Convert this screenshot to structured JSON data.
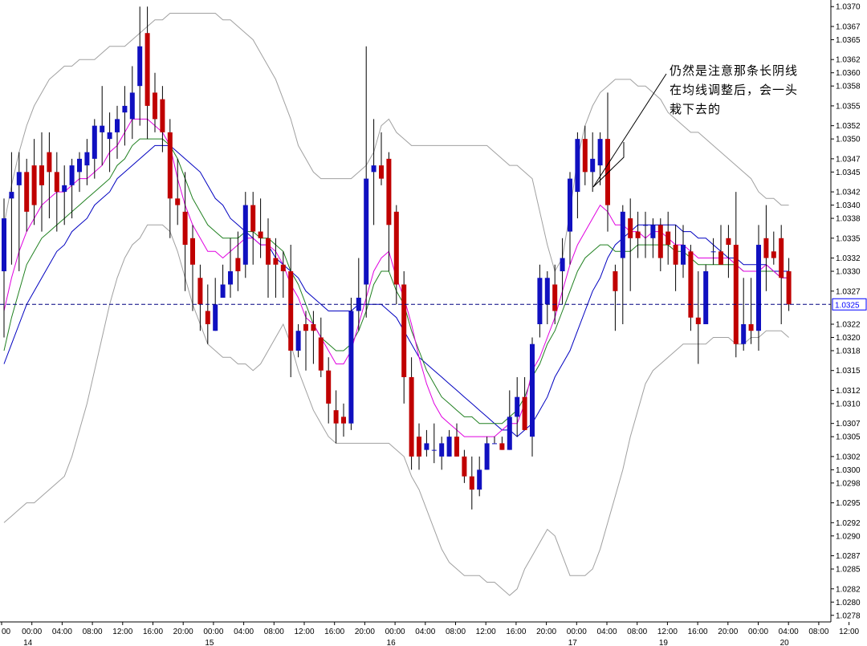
{
  "chart_data": {
    "type": "candlestick",
    "ylim": [
      1.0277,
      1.0371
    ],
    "grid": false,
    "colors": {
      "up": "#1010c0",
      "down": "#c00000",
      "upper_lower_band": "#a0a0a0",
      "fast_ma": "#e000e0",
      "mid_ma": "#208020",
      "slow_ma": "#0000c0",
      "current_price_line": "#000080",
      "current_price_box": "#0000ff"
    },
    "current_price": "1.0325",
    "y_ticks": [
      "1.0370",
      "1.0367",
      "1.0365",
      "1.0362",
      "1.0360",
      "1.0358",
      "1.0355",
      "1.0352",
      "1.0350",
      "1.0347",
      "1.0345",
      "1.0342",
      "1.0340",
      "1.0338",
      "1.0335",
      "1.0332",
      "1.0330",
      "1.0327",
      "1.0322",
      "1.0320",
      "1.0318",
      "1.0315",
      "1.0312",
      "1.0310",
      "1.0307",
      "1.0305",
      "1.0302",
      "1.0300",
      "1.0298",
      "1.0295",
      "1.0292",
      "1.0290",
      "1.0287",
      "1.0285",
      "1.0282",
      "1.0280",
      "1.0278"
    ],
    "x_time_labels": [
      "00",
      "00:00",
      "04:00",
      "08:00",
      "12:00",
      "16:00",
      "20:00",
      "00:00",
      "04:00",
      "08:00",
      "12:00",
      "16:00",
      "20:00",
      "00:00",
      "04:00",
      "08:00",
      "12:00",
      "16:00",
      "20:00",
      "00:00",
      "04:00",
      "08:00",
      "12:00",
      "16:00",
      "20:00",
      "00:00",
      "04:00",
      "08:00",
      "12:00",
      "16:00",
      "20:00",
      "00:00",
      "04:00"
    ],
    "x_day_labels": [
      "14",
      "15",
      "16",
      "17",
      "19",
      "20"
    ],
    "candles": [
      {
        "o": 1.033,
        "h": 1.0341,
        "l": 1.032,
        "c": 1.0338
      },
      {
        "o": 1.0341,
        "h": 1.0348,
        "l": 1.0331,
        "c": 1.0342
      },
      {
        "o": 1.0343,
        "h": 1.0348,
        "l": 1.033,
        "c": 1.0345
      },
      {
        "o": 1.0345,
        "h": 1.0347,
        "l": 1.0336,
        "c": 1.0339
      },
      {
        "o": 1.0346,
        "h": 1.035,
        "l": 1.0337,
        "c": 1.034
      },
      {
        "o": 1.0346,
        "h": 1.0351,
        "l": 1.0336,
        "c": 1.0343
      },
      {
        "o": 1.0348,
        "h": 1.0351,
        "l": 1.0338,
        "c": 1.0345
      },
      {
        "o": 1.0345,
        "h": 1.0348,
        "l": 1.0336,
        "c": 1.0342
      },
      {
        "o": 1.0342,
        "h": 1.0346,
        "l": 1.0337,
        "c": 1.0343
      },
      {
        "o": 1.0343,
        "h": 1.0347,
        "l": 1.0338,
        "c": 1.0346
      },
      {
        "o": 1.0345,
        "h": 1.0348,
        "l": 1.0342,
        "c": 1.0347
      },
      {
        "o": 1.0346,
        "h": 1.035,
        "l": 1.0343,
        "c": 1.0348
      },
      {
        "o": 1.0347,
        "h": 1.0353,
        "l": 1.0344,
        "c": 1.0352
      },
      {
        "o": 1.0351,
        "h": 1.0358,
        "l": 1.0346,
        "c": 1.0352
      },
      {
        "o": 1.035,
        "h": 1.0354,
        "l": 1.0345,
        "c": 1.0351
      },
      {
        "o": 1.0351,
        "h": 1.0355,
        "l": 1.0347,
        "c": 1.0353
      },
      {
        "o": 1.0354,
        "h": 1.0358,
        "l": 1.0349,
        "c": 1.0355
      },
      {
        "o": 1.0353,
        "h": 1.0361,
        "l": 1.035,
        "c": 1.0357
      },
      {
        "o": 1.0358,
        "h": 1.037,
        "l": 1.0352,
        "c": 1.0364
      },
      {
        "o": 1.0366,
        "h": 1.037,
        "l": 1.035,
        "c": 1.0355
      },
      {
        "o": 1.0357,
        "h": 1.036,
        "l": 1.0351,
        "c": 1.0353
      },
      {
        "o": 1.0356,
        "h": 1.0358,
        "l": 1.0348,
        "c": 1.0351
      },
      {
        "o": 1.0351,
        "h": 1.0353,
        "l": 1.0335,
        "c": 1.0341
      },
      {
        "o": 1.0341,
        "h": 1.0347,
        "l": 1.0337,
        "c": 1.034
      },
      {
        "o": 1.0339,
        "h": 1.0345,
        "l": 1.0327,
        "c": 1.0334
      },
      {
        "o": 1.0335,
        "h": 1.0337,
        "l": 1.0324,
        "c": 1.0331
      },
      {
        "o": 1.0329,
        "h": 1.0331,
        "l": 1.0321,
        "c": 1.0325
      },
      {
        "o": 1.0324,
        "h": 1.0328,
        "l": 1.0319,
        "c": 1.0322
      },
      {
        "o": 1.0321,
        "h": 1.0329,
        "l": 1.0321,
        "c": 1.0325
      },
      {
        "o": 1.0326,
        "h": 1.0331,
        "l": 1.0326,
        "c": 1.0328
      },
      {
        "o": 1.0328,
        "h": 1.0335,
        "l": 1.0326,
        "c": 1.033
      },
      {
        "o": 1.0332,
        "h": 1.0336,
        "l": 1.0327,
        "c": 1.033
      },
      {
        "o": 1.0331,
        "h": 1.0342,
        "l": 1.0329,
        "c": 1.034
      },
      {
        "o": 1.034,
        "h": 1.0342,
        "l": 1.0331,
        "c": 1.0336
      },
      {
        "o": 1.0336,
        "h": 1.0341,
        "l": 1.0332,
        "c": 1.0335
      },
      {
        "o": 1.0335,
        "h": 1.0338,
        "l": 1.0326,
        "c": 1.0331
      },
      {
        "o": 1.0332,
        "h": 1.0335,
        "l": 1.0326,
        "c": 1.0331
      },
      {
        "o": 1.0331,
        "h": 1.0333,
        "l": 1.0326,
        "c": 1.033
      },
      {
        "o": 1.033,
        "h": 1.0334,
        "l": 1.0314,
        "c": 1.0318
      },
      {
        "o": 1.0318,
        "h": 1.0322,
        "l": 1.0317,
        "c": 1.0321
      },
      {
        "o": 1.0322,
        "h": 1.0324,
        "l": 1.0315,
        "c": 1.0321
      },
      {
        "o": 1.0322,
        "h": 1.0324,
        "l": 1.0316,
        "c": 1.0321
      },
      {
        "o": 1.032,
        "h": 1.0323,
        "l": 1.0314,
        "c": 1.0315
      },
      {
        "o": 1.0315,
        "h": 1.0317,
        "l": 1.0307,
        "c": 1.031
      },
      {
        "o": 1.0309,
        "h": 1.0312,
        "l": 1.0304,
        "c": 1.0307
      },
      {
        "o": 1.0308,
        "h": 1.031,
        "l": 1.0305,
        "c": 1.0307
      },
      {
        "o": 1.0307,
        "h": 1.0326,
        "l": 1.0306,
        "c": 1.0324
      },
      {
        "o": 1.0324,
        "h": 1.0332,
        "l": 1.0321,
        "c": 1.0326
      },
      {
        "o": 1.0328,
        "h": 1.0364,
        "l": 1.0323,
        "c": 1.0344
      },
      {
        "o": 1.0345,
        "h": 1.0353,
        "l": 1.0337,
        "c": 1.0346
      },
      {
        "o": 1.0346,
        "h": 1.0351,
        "l": 1.0343,
        "c": 1.0344
      },
      {
        "o": 1.0347,
        "h": 1.0348,
        "l": 1.033,
        "c": 1.0337
      },
      {
        "o": 1.0339,
        "h": 1.034,
        "l": 1.0325,
        "c": 1.0328
      },
      {
        "o": 1.0328,
        "h": 1.033,
        "l": 1.031,
        "c": 1.0314
      },
      {
        "o": 1.0314,
        "h": 1.0317,
        "l": 1.03,
        "c": 1.0302
      },
      {
        "o": 1.0305,
        "h": 1.0307,
        "l": 1.03,
        "c": 1.0302
      },
      {
        "o": 1.0303,
        "h": 1.0306,
        "l": 1.0302,
        "c": 1.0304
      },
      {
        "o": 1.0303,
        "h": 1.0307,
        "l": 1.0301,
        "c": 1.0303
      },
      {
        "o": 1.0302,
        "h": 1.0305,
        "l": 1.03,
        "c": 1.0304
      },
      {
        "o": 1.0302,
        "h": 1.0306,
        "l": 1.0302,
        "c": 1.0305
      },
      {
        "o": 1.0305,
        "h": 1.0307,
        "l": 1.0302,
        "c": 1.0302
      },
      {
        "o": 1.0302,
        "h": 1.0303,
        "l": 1.0298,
        "c": 1.0299
      },
      {
        "o": 1.0299,
        "h": 1.0302,
        "l": 1.0294,
        "c": 1.0297
      },
      {
        "o": 1.0297,
        "h": 1.0302,
        "l": 1.0296,
        "c": 1.03
      },
      {
        "o": 1.03,
        "h": 1.0305,
        "l": 1.03,
        "c": 1.0304
      },
      {
        "o": 1.0304,
        "h": 1.0305,
        "l": 1.0304,
        "c": 1.0304
      },
      {
        "o": 1.0304,
        "h": 1.0305,
        "l": 1.0303,
        "c": 1.0303
      },
      {
        "o": 1.0303,
        "h": 1.0312,
        "l": 1.0303,
        "c": 1.0308
      },
      {
        "o": 1.0308,
        "h": 1.0314,
        "l": 1.0305,
        "c": 1.0311
      },
      {
        "o": 1.0311,
        "h": 1.0314,
        "l": 1.0306,
        "c": 1.0306
      },
      {
        "o": 1.0305,
        "h": 1.032,
        "l": 1.0302,
        "c": 1.0319
      },
      {
        "o": 1.0322,
        "h": 1.0331,
        "l": 1.032,
        "c": 1.0329
      },
      {
        "o": 1.0325,
        "h": 1.033,
        "l": 1.0322,
        "c": 1.0329
      },
      {
        "o": 1.0328,
        "h": 1.0331,
        "l": 1.0322,
        "c": 1.0324
      },
      {
        "o": 1.033,
        "h": 1.0335,
        "l": 1.0325,
        "c": 1.0332
      },
      {
        "o": 1.0336,
        "h": 1.0345,
        "l": 1.0331,
        "c": 1.0344
      },
      {
        "o": 1.0342,
        "h": 1.0351,
        "l": 1.0338,
        "c": 1.035
      },
      {
        "o": 1.035,
        "h": 1.0352,
        "l": 1.0343,
        "c": 1.0345
      },
      {
        "o": 1.0345,
        "h": 1.0351,
        "l": 1.0342,
        "c": 1.0347
      },
      {
        "o": 1.0346,
        "h": 1.0351,
        "l": 1.0343,
        "c": 1.035
      },
      {
        "o": 1.035,
        "h": 1.0357,
        "l": 1.0336,
        "c": 1.034
      },
      {
        "o": 1.033,
        "h": 1.0331,
        "l": 1.0321,
        "c": 1.0327
      },
      {
        "o": 1.0332,
        "h": 1.034,
        "l": 1.0322,
        "c": 1.0339
      },
      {
        "o": 1.0338,
        "h": 1.0341,
        "l": 1.0327,
        "c": 1.0335
      },
      {
        "o": 1.0336,
        "h": 1.0339,
        "l": 1.0332,
        "c": 1.0335
      },
      {
        "o": 1.0337,
        "h": 1.0339,
        "l": 1.0332,
        "c": 1.0337
      },
      {
        "o": 1.0335,
        "h": 1.0338,
        "l": 1.0332,
        "c": 1.0337
      },
      {
        "o": 1.0337,
        "h": 1.0338,
        "l": 1.033,
        "c": 1.0332
      },
      {
        "o": 1.0336,
        "h": 1.0339,
        "l": 1.0331,
        "c": 1.0334
      },
      {
        "o": 1.0334,
        "h": 1.0337,
        "l": 1.0327,
        "c": 1.0331
      },
      {
        "o": 1.0331,
        "h": 1.0337,
        "l": 1.0329,
        "c": 1.0334
      },
      {
        "o": 1.0333,
        "h": 1.0334,
        "l": 1.0321,
        "c": 1.0323
      },
      {
        "o": 1.0323,
        "h": 1.033,
        "l": 1.0316,
        "c": 1.0322
      },
      {
        "o": 1.0322,
        "h": 1.0331,
        "l": 1.0322,
        "c": 1.033
      },
      {
        "o": 1.0333,
        "h": 1.0335,
        "l": 1.0331,
        "c": 1.0333
      },
      {
        "o": 1.0333,
        "h": 1.0337,
        "l": 1.0331,
        "c": 1.0331
      },
      {
        "o": 1.0335,
        "h": 1.0337,
        "l": 1.0329,
        "c": 1.0334
      },
      {
        "o": 1.0334,
        "h": 1.0342,
        "l": 1.0317,
        "c": 1.0319
      },
      {
        "o": 1.0319,
        "h": 1.0329,
        "l": 1.0318,
        "c": 1.0322
      },
      {
        "o": 1.0322,
        "h": 1.0329,
        "l": 1.0319,
        "c": 1.0321
      },
      {
        "o": 1.0321,
        "h": 1.0337,
        "l": 1.0318,
        "c": 1.0334
      },
      {
        "o": 1.0335,
        "h": 1.034,
        "l": 1.0327,
        "c": 1.0332
      },
      {
        "o": 1.0333,
        "h": 1.0336,
        "l": 1.0331,
        "c": 1.0332
      },
      {
        "o": 1.0335,
        "h": 1.0337,
        "l": 1.0322,
        "c": 1.0329
      },
      {
        "o": 1.033,
        "h": 1.0332,
        "l": 1.0324,
        "c": 1.0325
      }
    ],
    "upper_band": [
      1.0337,
      1.0343,
      1.0348,
      1.0352,
      1.0355,
      1.0357,
      1.0359,
      1.036,
      1.0361,
      1.0361,
      1.0362,
      1.0362,
      1.0362,
      1.0363,
      1.0364,
      1.0364,
      1.0364,
      1.0365,
      1.0366,
      1.0367,
      1.0368,
      1.0368,
      1.0369,
      1.0369,
      1.0369,
      1.0369,
      1.0369,
      1.0369,
      1.0369,
      1.0368,
      1.0368,
      1.0367,
      1.0366,
      1.0365,
      1.0363,
      1.0361,
      1.0359,
      1.0356,
      1.0353,
      1.0349,
      1.0347,
      1.0345,
      1.0344,
      1.0344,
      1.0344,
      1.0344,
      1.0344,
      1.0345,
      1.0346,
      1.0348,
      1.0352,
      1.0353,
      1.0351,
      1.035,
      1.0349,
      1.0349,
      1.0349,
      1.0349,
      1.0349,
      1.0349,
      1.0349,
      1.0349,
      1.0349,
      1.0349,
      1.0349,
      1.0348,
      1.0347,
      1.0346,
      1.0346,
      1.0345,
      1.0344,
      1.0339,
      1.0334,
      1.033,
      1.0332,
      1.0339,
      1.0347,
      1.0352,
      1.0355,
      1.0357,
      1.0358,
      1.0359,
      1.0359,
      1.0359,
      1.0358,
      1.0358,
      1.0357,
      1.0356,
      1.0354,
      1.0353,
      1.0352,
      1.0351,
      1.0351,
      1.035,
      1.0349,
      1.0348,
      1.0347,
      1.0346,
      1.0345,
      1.0344,
      1.0342,
      1.0341,
      1.0341,
      1.034,
      1.034
    ],
    "lower_band": [
      1.0292,
      1.0293,
      1.0294,
      1.0295,
      1.0295,
      1.0296,
      1.0297,
      1.0298,
      1.0299,
      1.0302,
      1.0306,
      1.031,
      1.0315,
      1.032,
      1.0325,
      1.0329,
      1.0332,
      1.0334,
      1.0335,
      1.0337,
      1.0337,
      1.0337,
      1.0336,
      1.0333,
      1.0329,
      1.0325,
      1.0322,
      1.0319,
      1.0318,
      1.0317,
      1.0317,
      1.0316,
      1.0316,
      1.0315,
      1.0316,
      1.0318,
      1.032,
      1.0322,
      1.0319,
      1.0315,
      1.0312,
      1.0309,
      1.0307,
      1.0305,
      1.0304,
      1.0304,
      1.0304,
      1.0304,
      1.0304,
      1.0304,
      1.0304,
      1.0304,
      1.0303,
      1.0302,
      1.0299,
      1.0297,
      1.0294,
      1.0291,
      1.0288,
      1.0286,
      1.0285,
      1.0284,
      1.0284,
      1.0284,
      1.0283,
      1.0283,
      1.0282,
      1.0281,
      1.0282,
      1.0285,
      1.0287,
      1.0289,
      1.0291,
      1.029,
      1.0287,
      1.0284,
      1.0284,
      1.0284,
      1.0285,
      1.0288,
      1.0292,
      1.0296,
      1.03,
      1.0305,
      1.0309,
      1.0313,
      1.0315,
      1.0316,
      1.0317,
      1.0318,
      1.0319,
      1.0319,
      1.0319,
      1.0319,
      1.032,
      1.032,
      1.032,
      1.0319,
      1.0319,
      1.032,
      1.032,
      1.0321,
      1.0321,
      1.0321,
      1.032
    ],
    "fast_ma": [
      1.0324,
      1.0329,
      1.0333,
      1.0336,
      1.0338,
      1.034,
      1.0341,
      1.0342,
      1.0342,
      1.0343,
      1.0344,
      1.0344,
      1.0345,
      1.0346,
      1.0348,
      1.0349,
      1.0351,
      1.0353,
      1.0353,
      1.0353,
      1.0352,
      1.0351,
      1.0349,
      1.0344,
      1.034,
      1.0337,
      1.0335,
      1.0333,
      1.0333,
      1.0332,
      1.0333,
      1.0334,
      1.0335,
      1.0335,
      1.0334,
      1.0334,
      1.0333,
      1.0331,
      1.0328,
      1.0326,
      1.0323,
      1.0322,
      1.032,
      1.0318,
      1.0316,
      1.0316,
      1.0318,
      1.0322,
      1.0326,
      1.033,
      1.0332,
      1.0333,
      1.0329,
      1.0326,
      1.0322,
      1.0317,
      1.0313,
      1.031,
      1.0308,
      1.0307,
      1.0306,
      1.0305,
      1.0305,
      1.0305,
      1.0305,
      1.0305,
      1.0306,
      1.0307,
      1.0307,
      1.031,
      1.0315,
      1.0317,
      1.032,
      1.0323,
      1.0327,
      1.0331,
      1.0334,
      1.0336,
      1.0338,
      1.034,
      1.0339,
      1.0337,
      1.0337,
      1.0336,
      1.0336,
      1.0335,
      1.0336,
      1.0336,
      1.0335,
      1.0334,
      1.0334,
      1.0333,
      1.0332,
      1.0332,
      1.0332,
      1.0332,
      1.0332,
      1.0331,
      1.033,
      1.033,
      1.033,
      1.0331,
      1.033,
      1.0329,
      1.0329
    ],
    "mid_ma": [
      1.0318,
      1.0323,
      1.0327,
      1.0331,
      1.0333,
      1.0335,
      1.0336,
      1.0337,
      1.0338,
      1.0339,
      1.034,
      1.0341,
      1.0342,
      1.0343,
      1.0344,
      1.0346,
      1.0347,
      1.0349,
      1.035,
      1.035,
      1.035,
      1.035,
      1.0349,
      1.0347,
      1.0344,
      1.0341,
      1.0339,
      1.0337,
      1.0336,
      1.0335,
      1.0335,
      1.0335,
      1.0336,
      1.0336,
      1.0335,
      1.0335,
      1.0334,
      1.0333,
      1.033,
      1.0328,
      1.0325,
      1.0322,
      1.032,
      1.0319,
      1.0318,
      1.0318,
      1.0319,
      1.0321,
      1.0324,
      1.0328,
      1.033,
      1.033,
      1.0327,
      1.0325,
      1.0321,
      1.0318,
      1.0315,
      1.0313,
      1.0311,
      1.031,
      1.0309,
      1.0308,
      1.0308,
      1.0307,
      1.0307,
      1.0307,
      1.0307,
      1.0308,
      1.0309,
      1.0311,
      1.0314,
      1.0316,
      1.0319,
      1.0321,
      1.0324,
      1.0327,
      1.033,
      1.0332,
      1.0333,
      1.0334,
      1.0334,
      1.0333,
      1.0333,
      1.0333,
      1.0334,
      1.0334,
      1.0334,
      1.0334,
      1.0334,
      1.0333,
      1.0333,
      1.0332,
      1.0331,
      1.0331,
      1.0331,
      1.0331,
      1.0331,
      1.0331,
      1.033,
      1.033,
      1.033,
      1.033,
      1.033,
      1.0329,
      1.0329
    ],
    "slow_ma": [
      1.0316,
      1.0319,
      1.0322,
      1.0325,
      1.0327,
      1.0329,
      1.0331,
      1.0333,
      1.0334,
      1.0336,
      1.0337,
      1.0338,
      1.034,
      1.0341,
      1.0342,
      1.0344,
      1.0345,
      1.0346,
      1.0347,
      1.0348,
      1.0349,
      1.0349,
      1.0349,
      1.0348,
      1.0347,
      1.0346,
      1.0345,
      1.0343,
      1.0341,
      1.034,
      1.0338,
      1.0337,
      1.0336,
      1.0335,
      1.0334,
      1.0334,
      1.0332,
      1.0331,
      1.033,
      1.0329,
      1.0327,
      1.0326,
      1.0325,
      1.0324,
      1.0324,
      1.0324,
      1.0324,
      1.0325,
      1.0325,
      1.0325,
      1.0325,
      1.0324,
      1.0323,
      1.0321,
      1.0319,
      1.0317,
      1.0316,
      1.0315,
      1.0314,
      1.0313,
      1.0312,
      1.0311,
      1.031,
      1.0309,
      1.0308,
      1.0307,
      1.0306,
      1.0306,
      1.0305,
      1.0306,
      1.0307,
      1.0309,
      1.0311,
      1.0314,
      1.0316,
      1.0318,
      1.0321,
      1.0324,
      1.0327,
      1.0329,
      1.0332,
      1.0334,
      1.0335,
      1.0336,
      1.0337,
      1.0337,
      1.0337,
      1.0337,
      1.0337,
      1.0337,
      1.0336,
      1.0336,
      1.0335,
      1.0335,
      1.0334,
      1.0333,
      1.0332,
      1.0332,
      1.0331,
      1.0331,
      1.0331,
      1.0331,
      1.033,
      1.033,
      1.033
    ],
    "annotation": "仍然是注意那条长阴线\n在均线调整后，会一头\n栽下去的"
  }
}
